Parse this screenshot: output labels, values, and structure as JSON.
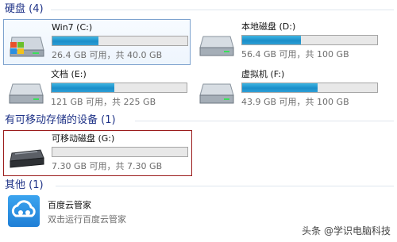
{
  "groups": {
    "hard_disks": {
      "label": "硬盘 (4)"
    },
    "removable": {
      "label": "有可移动存储的设备 (1)"
    },
    "other": {
      "label": "其他 (1)"
    }
  },
  "drives": [
    {
      "name": "Win7 (C:)",
      "info": "26.4 GB 可用，共 40.0 GB",
      "used_fraction": 0.34,
      "icon": "windows-drive-icon",
      "state": "selected"
    },
    {
      "name": "本地磁盘 (D:)",
      "info": "56.4 GB 可用，共 100 GB",
      "used_fraction": 0.436,
      "icon": "hard-drive-icon",
      "state": "normal"
    },
    {
      "name": "文档 (E:)",
      "info": "121 GB 可用，共 225 GB",
      "used_fraction": 0.462,
      "icon": "hard-drive-icon",
      "state": "normal"
    },
    {
      "name": "虚拟机 (F:)",
      "info": "43.9 GB 可用，共 100 GB",
      "used_fraction": 0.561,
      "icon": "hard-drive-icon",
      "state": "normal"
    }
  ],
  "removable_drive": {
    "name": "可移动磁盘 (G:)",
    "info": "7.30 GB 可用，共 7.30 GB",
    "used_fraction": 0.0,
    "icon": "removable-drive-icon",
    "state": "focused"
  },
  "other_item": {
    "name": "百度云管家",
    "description": "双击运行百度云管家",
    "icon": "baidu-cloud-icon"
  },
  "watermark": "头条 @学识电脑科技",
  "colors": {
    "header_text": "#1e3287",
    "bar_fill": "#1a8ec9",
    "focus_border": "#9b1c1c",
    "select_border": "#7da2ce"
  }
}
